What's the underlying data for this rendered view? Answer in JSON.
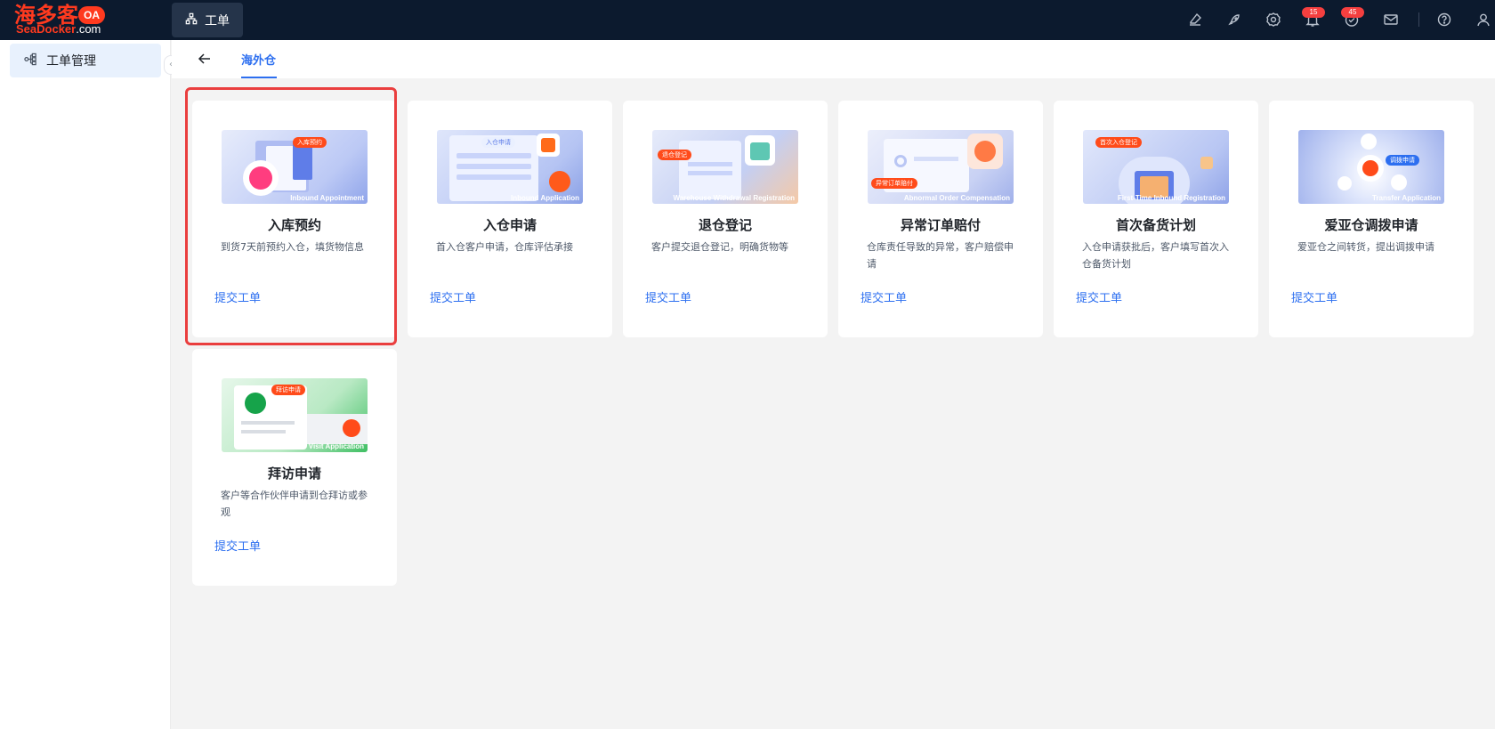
{
  "topbar": {
    "logo_cn": "海多客",
    "logo_en_brand": "SeaDocker",
    "logo_en_suffix": ".com",
    "logo_badge": "OA",
    "active_tab": "工单",
    "icons": [
      "broom-icon",
      "rocket-icon",
      "settings-icon",
      "bell-icon",
      "check-circle-icon",
      "mail-icon",
      "help-icon",
      "user-icon"
    ],
    "bell_badge": "15",
    "todo_badge": "45"
  },
  "sidebar": {
    "items": [
      {
        "label": "工单管理",
        "icon": "share-nodes-icon"
      }
    ]
  },
  "subheader": {
    "tab_label": "海外仓"
  },
  "cards": [
    {
      "title": "入库预约",
      "desc": "到货7天前预约入仓，填货物信息",
      "action": "提交工单",
      "thumb_caption": "Inbound Appointment",
      "thumb_tag": "入库预约"
    },
    {
      "title": "入仓申请",
      "desc": "首入仓客户申请，仓库评估承接",
      "action": "提交工单",
      "thumb_caption": "Inbound Application",
      "thumb_tag": "入仓申请"
    },
    {
      "title": "退仓登记",
      "desc": "客户提交退仓登记，明确货物等",
      "action": "提交工单",
      "thumb_caption": "Warehouse Withdrawal Registration",
      "thumb_tag": "退仓登记"
    },
    {
      "title": "异常订单赔付",
      "desc": "仓库责任导致的异常，客户赔偿申请",
      "action": "提交工单",
      "thumb_caption": "Abnormal Order Compensation",
      "thumb_tag": "异常订单赔付"
    },
    {
      "title": "首次备货计划",
      "desc": "入仓申请获批后，客户填写首次入仓备货计划",
      "action": "提交工单",
      "thumb_caption": "First-Time Inbound Registration",
      "thumb_tag": "首次入仓登记"
    },
    {
      "title": "爱亚仓调拨申请",
      "desc": "爱亚仓之间转货，提出调拨申请",
      "action": "提交工单",
      "thumb_caption": "Transfer Application",
      "thumb_tag": "调拨申请"
    },
    {
      "title": "拜访申请",
      "desc": "客户等合作伙伴申请到仓拜访或参观",
      "action": "提交工单",
      "thumb_caption": "Visit Application",
      "thumb_tag": "拜访申请"
    }
  ],
  "colors": {
    "topbar_bg": "#0c1a2e",
    "accent": "#2d6ff0",
    "brand": "#ff3a1f",
    "highlight": "#ea3e3e"
  }
}
